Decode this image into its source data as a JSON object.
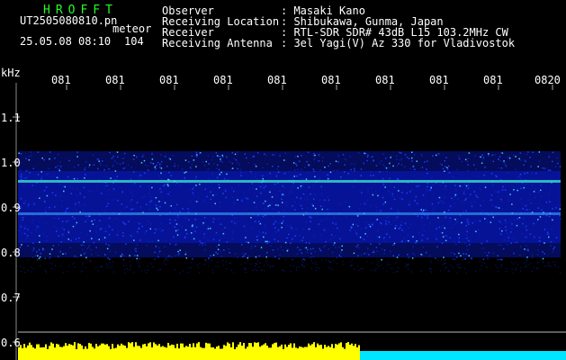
{
  "header": {
    "logo": "HROFFT",
    "filename": "UT2505080810.pn",
    "suffix": "meteor",
    "datetime": "25.05.08 08:10",
    "count": "104",
    "labels": [
      "Observer",
      "Receiving Location",
      "Receiver",
      "Receiving Antenna"
    ],
    "values": [
      ": Masaki Kano",
      ": Shibukawa, Gunma, Japan",
      ": RTL-SDR SDR# 43dB L15 103.2MHz CW",
      ": 3el Yagi(V) Az 330 for Vladivostok"
    ]
  },
  "axis": {
    "unit": "kHz",
    "y_ticks": [
      "1.1",
      "1.0",
      "0.9",
      "0.8",
      "0.7",
      "0.6"
    ],
    "x_ticks": [
      "081",
      "081",
      "081",
      "081",
      "081",
      "081",
      "081",
      "081",
      "081",
      "0820"
    ]
  },
  "colors": {
    "background": "#000000",
    "header_green": "#22ff22",
    "bar_yellow": "#ffff00",
    "bar_cyan": "#00e5ff",
    "signal_blue": "#0a1aff"
  }
}
